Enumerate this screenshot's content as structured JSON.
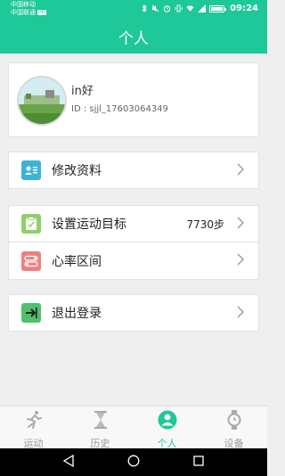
{
  "status_bar": {
    "carrier1": "中国移动",
    "carrier2": "中国联通",
    "hd_badge": "HD",
    "time": "09:24",
    "icons": [
      "bluetooth-icon",
      "mute-icon",
      "alarm-icon",
      "vibrate-icon",
      "wifi-icon",
      "signal-icon",
      "battery-icon"
    ]
  },
  "header": {
    "title": "个人"
  },
  "profile": {
    "name": "in好",
    "id_text": "ID : sjjl_17603064349"
  },
  "menu": [
    {
      "label": "修改资料",
      "icon": "profile-card-icon",
      "color": "#3bb3d6"
    },
    {
      "label": "设置运动目标",
      "value": "7730步",
      "icon": "target-clipboard-icon",
      "color": "#8fd06a"
    },
    {
      "label": "心率区间",
      "icon": "heart-rate-toggle-icon",
      "color": "#f07f7f"
    },
    {
      "label": "退出登录",
      "icon": "logout-arrow-icon",
      "color": "#4fc06d"
    }
  ],
  "tabs": [
    {
      "label": "运动",
      "icon": "running-icon",
      "active": false
    },
    {
      "label": "历史",
      "icon": "hourglass-icon",
      "active": false
    },
    {
      "label": "个人",
      "icon": "person-icon",
      "active": true
    },
    {
      "label": "设备",
      "icon": "watch-icon",
      "active": false
    }
  ],
  "nav": [
    "back-icon",
    "home-icon",
    "recents-icon"
  ],
  "colors": {
    "primary": "#1fc898",
    "background": "#efefef"
  }
}
